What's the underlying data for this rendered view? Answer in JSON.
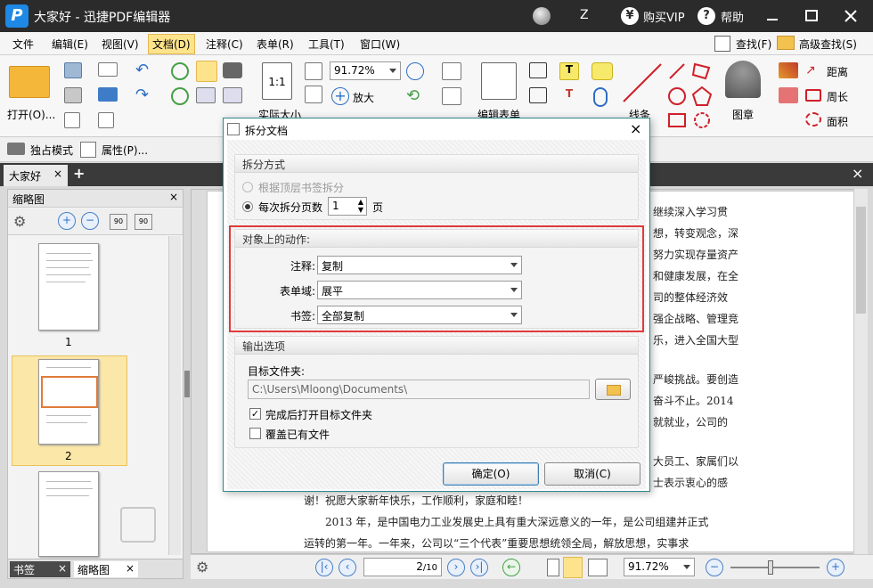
{
  "app": {
    "title": "大家好 - 迅捷PDF编辑器",
    "user_initial": "Z",
    "buy_vip": "购买VIP",
    "help": "帮助"
  },
  "menu": [
    "文件",
    "编辑(E)",
    "视图(V)",
    "文档(D)",
    "注释(C)",
    "表单(R)",
    "工具(T)",
    "窗口(W)"
  ],
  "menu_right": {
    "find": "查找(F)",
    "advanced_find": "高级查找(S)"
  },
  "ribbon": {
    "open": "打开(O)...",
    "zoom_value": "91.72%",
    "zoom_in_label": "放大",
    "actual_size": "实际大小",
    "edit_form": "编辑表单",
    "lines": "线条",
    "stamp": "图章",
    "distance": "距离",
    "perimeter": "周长",
    "area": "面积"
  },
  "toolbar2": {
    "exclusive_mode": "独占模式",
    "properties": "属性(P)..."
  },
  "doc_tab": "大家好",
  "left_panel": {
    "title": "缩略图",
    "pages": [
      "1",
      "2"
    ],
    "bottom_tabs": [
      "书签",
      "缩略图"
    ]
  },
  "document": {
    "right_lines": [
      "继续深入学习贯",
      "想，转变观念，深",
      "努力实现存量资产",
      "和健康发展，在全",
      "司的整体经济效",
      "强企战略、管理竞",
      "乐，进入全国大型"
    ],
    "right_lines2": [
      "严峻挑战。要创造",
      "奋斗不止。2014",
      "就就业，公司的"
    ],
    "right_lines3": [
      "大员工、家属们以",
      "士表示衷心的感"
    ],
    "bottom_lines": [
      "谢！祝愿大家新年快乐，工作顺利，家庭和睦！",
      "2013 年，是中国电力工业发展史上具有重大深远意义的一年，是公司组建并正式",
      "运转的第一年。一年来，公司以“三个代表”重要思想统领全局，解放思想，实事求"
    ]
  },
  "statusbar": {
    "page_input": "2",
    "page_total": "/10",
    "zoom": "91.72%"
  },
  "dialog": {
    "title": "拆分文档",
    "split_method": {
      "header": "拆分方式",
      "option_bookmark": "根据顶层书签拆分",
      "option_pages": "每次拆分页数",
      "pages_value": "1",
      "pages_unit": "页"
    },
    "actions": {
      "header": "对象上的动作:",
      "annotations_label": "注释:",
      "annotations_value": "复制",
      "form_label": "表单域:",
      "form_value": "展平",
      "bookmark_label": "书签:",
      "bookmark_value": "全部复制"
    },
    "output": {
      "header": "输出选项",
      "folder_label": "目标文件夹:",
      "folder_value": "C:\\Users\\Mloong\\Documents\\",
      "open_after": "完成后打开目标文件夹",
      "overwrite": "覆盖已有文件",
      "open_after_checked": true,
      "overwrite_checked": false
    },
    "ok": "确定(O)",
    "cancel": "取消(C)"
  },
  "colors": {
    "accent": "#1e88e5",
    "highlight": "#e03b3b",
    "active_menu": "#fde48c",
    "selection": "#fbe7a8"
  }
}
